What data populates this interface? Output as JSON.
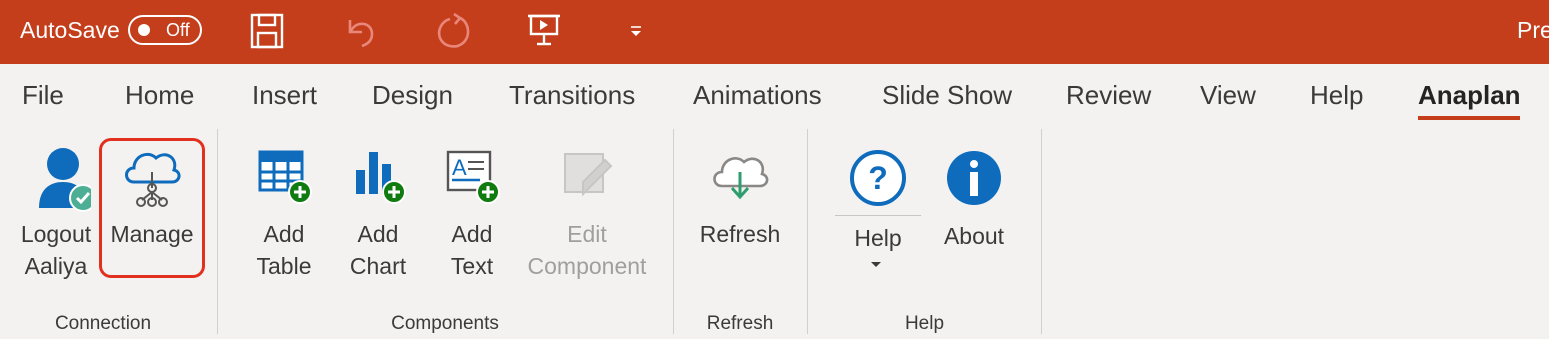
{
  "titlebar": {
    "autosave_label": "AutoSave",
    "autosave_state": "Off",
    "app_title": "Pre",
    "color": "#c43e1c"
  },
  "tabs": [
    {
      "label": "File"
    },
    {
      "label": "Home"
    },
    {
      "label": "Insert"
    },
    {
      "label": "Design"
    },
    {
      "label": "Transitions"
    },
    {
      "label": "Animations"
    },
    {
      "label": "Slide Show"
    },
    {
      "label": "Review"
    },
    {
      "label": "View"
    },
    {
      "label": "Help"
    },
    {
      "label": "Anaplan",
      "active": true
    }
  ],
  "ribbon": {
    "connection": {
      "group_label": "Connection",
      "logout": {
        "line1": "Logout",
        "line2": "Aaliya",
        "icon": "user-check-icon"
      },
      "manage": {
        "line1": "Manage",
        "icon": "cloud-network-icon",
        "highlighted": true
      }
    },
    "components": {
      "group_label": "Components",
      "add_table": {
        "line1": "Add",
        "line2": "Table",
        "icon": "table-add-icon"
      },
      "add_chart": {
        "line1": "Add",
        "line2": "Chart",
        "icon": "chart-add-icon"
      },
      "add_text": {
        "line1": "Add",
        "line2": "Text",
        "icon": "text-add-icon"
      },
      "edit_component": {
        "line1": "Edit",
        "line2": "Component",
        "icon": "edit-component-icon",
        "disabled": true
      }
    },
    "refresh": {
      "group_label": "Refresh",
      "refresh": {
        "line1": "Refresh",
        "icon": "cloud-download-icon"
      }
    },
    "help": {
      "group_label": "Help",
      "help": {
        "line1": "Help",
        "icon": "question-icon"
      },
      "about": {
        "line1": "About",
        "icon": "info-icon"
      }
    }
  }
}
